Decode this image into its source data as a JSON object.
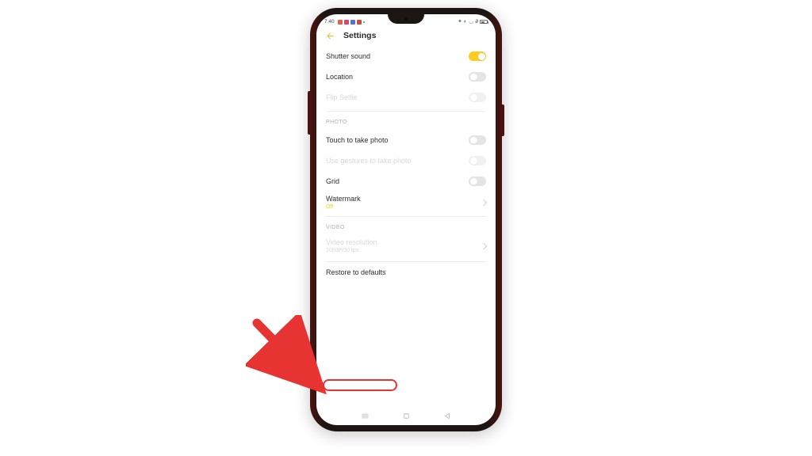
{
  "status": {
    "time": "7:40"
  },
  "header": {
    "title": "Settings"
  },
  "sections": [
    {
      "rows": [
        {
          "label": "Shutter sound",
          "control": "toggle",
          "on": true,
          "disabled": false
        },
        {
          "label": "Location",
          "control": "toggle",
          "on": false,
          "disabled": false
        },
        {
          "label": "Flip Selfie",
          "control": "toggle",
          "on": false,
          "disabled": true
        }
      ]
    },
    {
      "heading": "PHOTO",
      "rows": [
        {
          "label": "Touch to take photo",
          "control": "toggle",
          "on": false,
          "disabled": false
        },
        {
          "label": "Use gestures to take photo",
          "control": "toggle",
          "on": false,
          "disabled": true
        },
        {
          "label": "Grid",
          "control": "toggle",
          "on": false,
          "disabled": false
        },
        {
          "label": "Watermark",
          "sub": "Off",
          "subStyle": "accent",
          "control": "chevron",
          "disabled": false
        }
      ]
    },
    {
      "heading": "VIDEO",
      "rows": [
        {
          "label": "Video resolution",
          "sub": "1080P/30 fps",
          "subStyle": "grey",
          "control": "chevron",
          "disabled": true
        }
      ]
    }
  ],
  "restore": {
    "label": "Restore to defaults"
  }
}
